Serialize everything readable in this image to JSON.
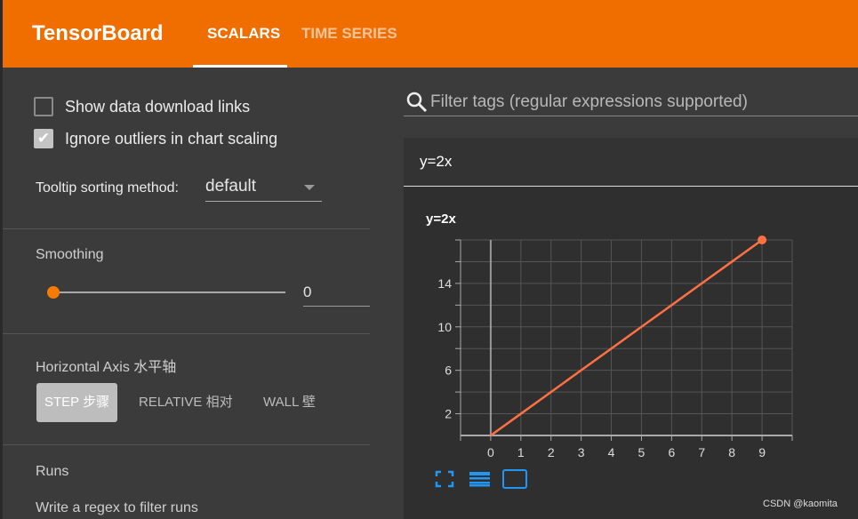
{
  "header": {
    "title": "TensorBoard",
    "tabs": [
      {
        "label": "SCALARS",
        "active": true
      },
      {
        "label": "TIME SERIES",
        "active": false
      }
    ],
    "color": "#f06e00"
  },
  "sidebar": {
    "show_download_links": {
      "label": "Show data download links",
      "checked": false
    },
    "ignore_outliers": {
      "label": "Ignore outliers in chart scaling",
      "checked": true
    },
    "tooltip_sorting": {
      "label": "Tooltip sorting method:",
      "value": "default"
    },
    "smoothing": {
      "label": "Smoothing",
      "value": "0",
      "fraction": 0
    },
    "horizontal_axis": {
      "label": "Horizontal Axis 水平轴",
      "options": [
        {
          "label": "STEP 步骤",
          "active": true
        },
        {
          "label": "RELATIVE 相对",
          "active": false
        },
        {
          "label": "WALL 壁",
          "active": false
        }
      ]
    },
    "runs": {
      "label": "Runs",
      "filter_placeholder": "Write a regex to filter runs"
    }
  },
  "main": {
    "filter_placeholder": "Filter tags (regular expressions supported)",
    "card_title": "y=2x"
  },
  "chart_data": {
    "type": "line",
    "title": "y=2x",
    "x": [
      0,
      1,
      2,
      3,
      4,
      5,
      6,
      7,
      8,
      9
    ],
    "series": [
      {
        "values": [
          0,
          2,
          4,
          6,
          8,
          10,
          12,
          14,
          16,
          18
        ],
        "color": "#ff7043"
      }
    ],
    "xlim": [
      -1,
      10
    ],
    "ylim": [
      0,
      18
    ],
    "xticks": [
      0,
      1,
      2,
      3,
      4,
      5,
      6,
      7,
      8,
      9
    ],
    "yticks": [
      2,
      6,
      10,
      14
    ],
    "grid": true
  },
  "watermark": "CSDN @kaomita"
}
